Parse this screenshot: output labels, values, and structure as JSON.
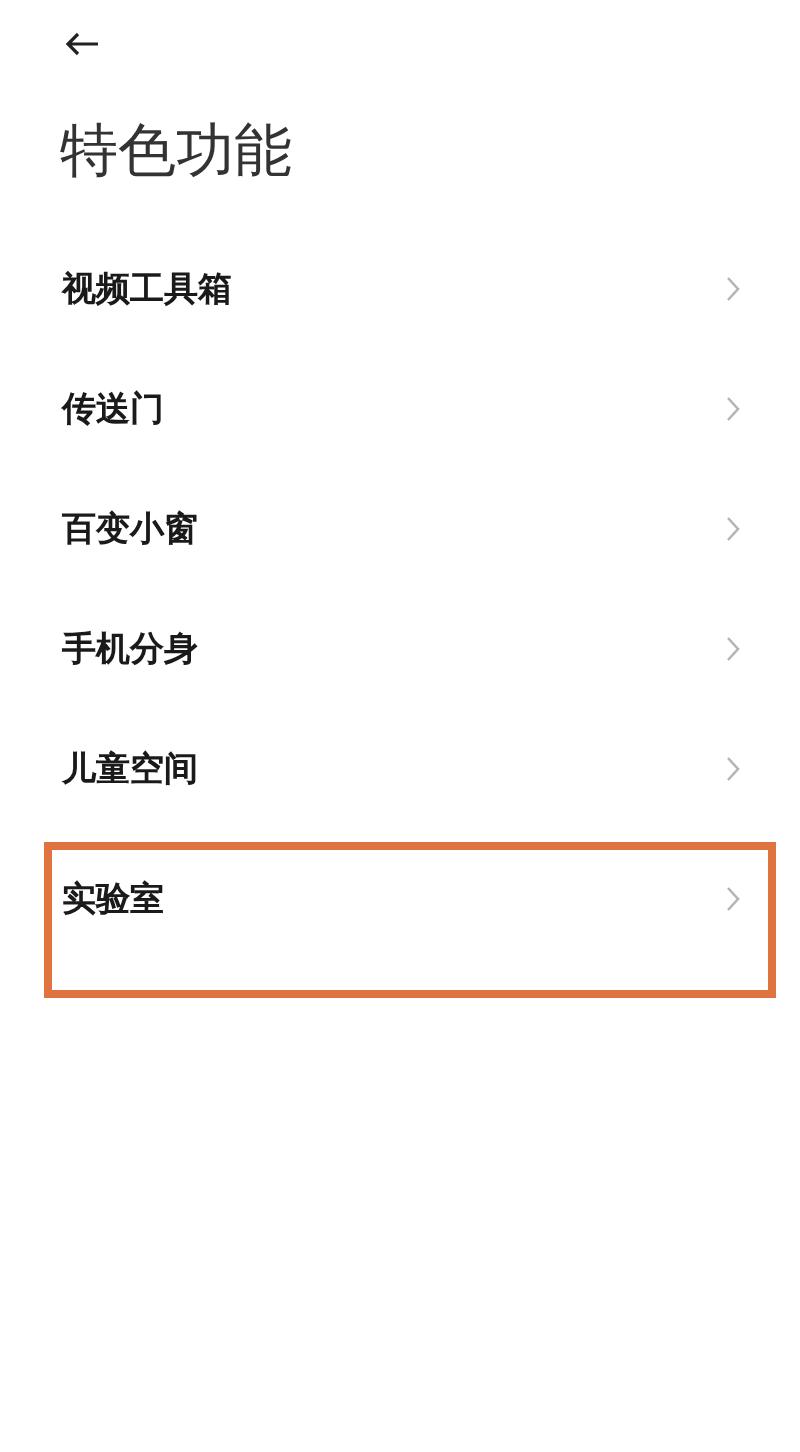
{
  "header": {
    "title": "特色功能"
  },
  "items": [
    {
      "label": "视频工具箱",
      "highlighted": false
    },
    {
      "label": "传送门",
      "highlighted": false
    },
    {
      "label": "百变小窗",
      "highlighted": false
    },
    {
      "label": "手机分身",
      "highlighted": false
    },
    {
      "label": "儿童空间",
      "highlighted": false
    },
    {
      "label": "实验室",
      "highlighted": true
    }
  ]
}
